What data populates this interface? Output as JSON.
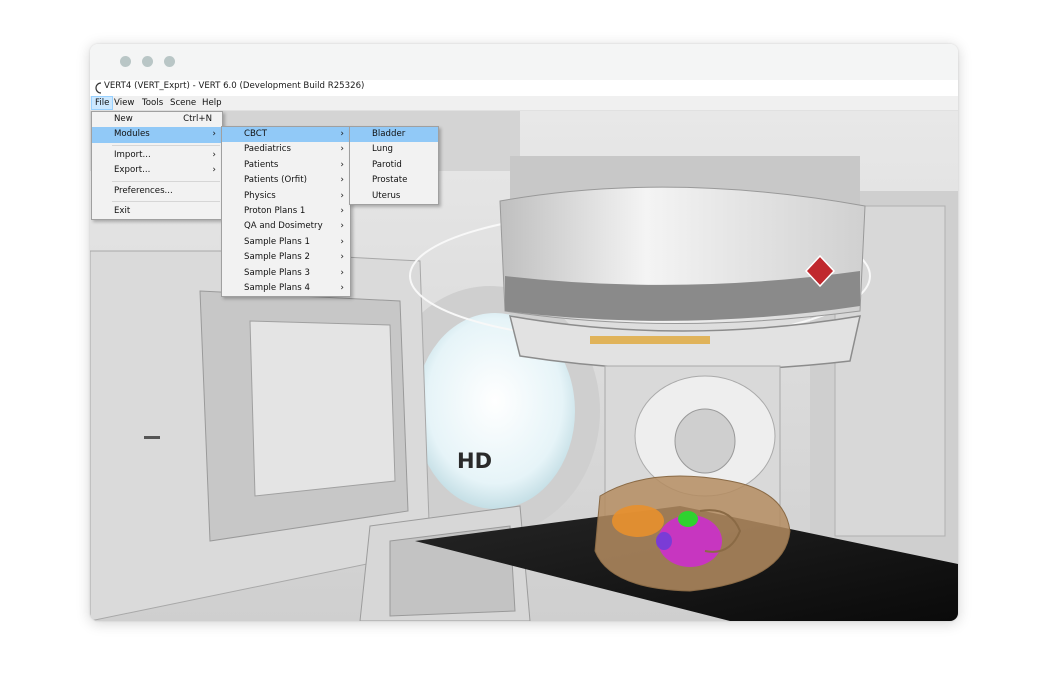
{
  "window": {
    "title": "VERT4 (VERT_Exprt) - VERT 6.0 (Development Build R25326)"
  },
  "menubar": {
    "items": [
      {
        "label": "File"
      },
      {
        "label": "View"
      },
      {
        "label": "Tools"
      },
      {
        "label": "Scene"
      },
      {
        "label": "Help"
      }
    ]
  },
  "file_menu": {
    "new": {
      "label": "New",
      "shortcut": "Ctrl+N"
    },
    "modules": {
      "label": "Modules"
    },
    "import": {
      "label": "Import..."
    },
    "export": {
      "label": "Export..."
    },
    "preferences": {
      "label": "Preferences..."
    },
    "exit": {
      "label": "Exit"
    }
  },
  "modules_menu": {
    "items": [
      {
        "label": "CBCT"
      },
      {
        "label": "Paediatrics"
      },
      {
        "label": "Patients"
      },
      {
        "label": "Patients (Orfit)"
      },
      {
        "label": "Physics"
      },
      {
        "label": "Proton Plans 1"
      },
      {
        "label": "QA and Dosimetry"
      },
      {
        "label": "Sample Plans 1"
      },
      {
        "label": "Sample Plans 2"
      },
      {
        "label": "Sample Plans 3"
      },
      {
        "label": "Sample Plans 4"
      }
    ]
  },
  "cbct_menu": {
    "items": [
      {
        "label": "Bladder"
      },
      {
        "label": "Lung"
      },
      {
        "label": "Parotid"
      },
      {
        "label": "Prostate"
      },
      {
        "label": "Uterus"
      }
    ]
  },
  "scene": {
    "bore_label": "HD"
  },
  "colors": {
    "highlight": "#91c9f7",
    "menu_background": "#f2f2f2",
    "window_dots": "#b9c6c6",
    "couch": "#111111"
  }
}
